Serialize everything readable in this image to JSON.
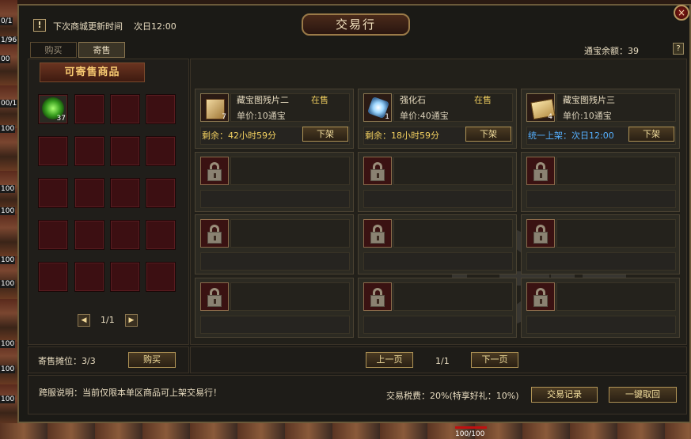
{
  "window": {
    "title": "交易行",
    "close_icon": "×"
  },
  "notice": {
    "icon": "!",
    "label": "下次商城更新时间",
    "time": "次日12:00"
  },
  "tabs": [
    {
      "label": "购买",
      "active": false
    },
    {
      "label": "寄售",
      "active": true
    }
  ],
  "balance": {
    "label": "通宝余额：39"
  },
  "help_label": "?",
  "left_panel": {
    "header": "可寄售商品",
    "items": [
      {
        "name": "gem",
        "count": "37"
      }
    ],
    "page": "1/1",
    "prev_arrow": "◀",
    "next_arrow": "▶",
    "stall_label": "寄售摊位：3/3",
    "buy_button": "购买"
  },
  "listings": [
    {
      "name": "藏宝图残片二",
      "status": "在售",
      "price": "单价:10通宝",
      "qty": "7",
      "timer": "剩余：42小时59分",
      "timer_blue": false,
      "delist": "下架",
      "icon": "scroll-icon"
    },
    {
      "name": "强化石",
      "status": "在售",
      "price": "单价:40通宝",
      "qty": "1",
      "timer": "剩余：18小时59分",
      "timer_blue": false,
      "delist": "下架",
      "icon": "crystal-icon"
    },
    {
      "name": "藏宝图残片三",
      "status": "",
      "price": "单价:10通宝",
      "qty": "4",
      "timer": "统一上架：次日12:00",
      "timer_blue": true,
      "delist": "下架",
      "icon": "map-scroll-icon"
    }
  ],
  "locked_slots": 9,
  "right_pager": {
    "prev": "上一页",
    "page": "1/1",
    "next": "下一页"
  },
  "bottom": {
    "desc": "跨服说明：当前仅限本单区商品可上架交易行！",
    "tax": "交易税费：20%(特享好礼：10%)",
    "records_button": "交易记录",
    "recall_button": "一键取回"
  },
  "background": {
    "side_numbers": [
      "0/1",
      "1/96",
      "00",
      "00/1",
      "100",
      "100",
      "100",
      "100",
      "100",
      "100",
      "100",
      "100"
    ],
    "hp": "100/100"
  },
  "colors": {
    "accent_gold": "#f2d060",
    "status_blue": "#55b0ff",
    "slot_red": "#3c0f12"
  }
}
